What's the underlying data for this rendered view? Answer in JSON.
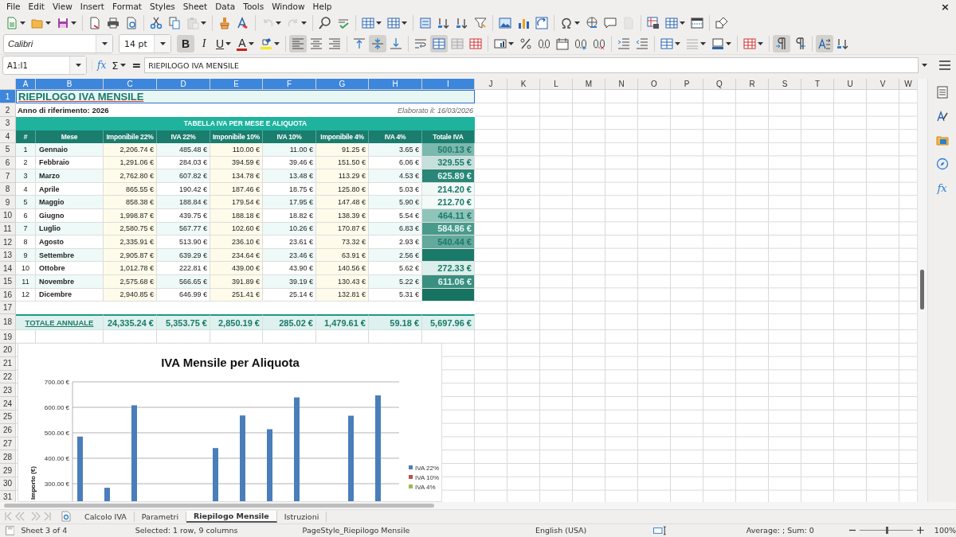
{
  "menu": [
    "File",
    "Edit",
    "View",
    "Insert",
    "Format",
    "Styles",
    "Sheet",
    "Data",
    "Tools",
    "Window",
    "Help"
  ],
  "close_button": "×",
  "toolbar_standard": [
    {
      "kind": "new",
      "dropdown": true,
      "disabled": false
    },
    {
      "kind": "open",
      "dropdown": true,
      "disabled": false
    },
    {
      "kind": "save",
      "dropdown": true,
      "disabled": false
    },
    {
      "kind": "separator"
    },
    {
      "kind": "pdf",
      "dropdown": false,
      "disabled": false
    },
    {
      "kind": "print",
      "dropdown": false,
      "disabled": false
    },
    {
      "kind": "preview",
      "dropdown": false,
      "disabled": false
    },
    {
      "kind": "separator"
    },
    {
      "kind": "cut",
      "dropdown": false,
      "disabled": false
    },
    {
      "kind": "copy",
      "dropdown": false,
      "disabled": false
    },
    {
      "kind": "paste",
      "dropdown": true,
      "disabled": true
    },
    {
      "kind": "separator"
    },
    {
      "kind": "clone",
      "dropdown": false,
      "disabled": false
    },
    {
      "kind": "clear",
      "dropdown": false,
      "disabled": false
    },
    {
      "kind": "separator"
    },
    {
      "kind": "undo",
      "dropdown": true,
      "disabled": true
    },
    {
      "kind": "redo",
      "dropdown": true,
      "disabled": true
    },
    {
      "kind": "separator"
    },
    {
      "kind": "find",
      "dropdown": false,
      "disabled": false
    },
    {
      "kind": "spelling",
      "dropdown": false,
      "disabled": false
    },
    {
      "kind": "separator"
    },
    {
      "kind": "rows",
      "dropdown": true,
      "disabled": false
    },
    {
      "kind": "cols",
      "dropdown": true,
      "disabled": false
    },
    {
      "kind": "separator"
    },
    {
      "kind": "sort",
      "dropdown": false,
      "disabled": false
    },
    {
      "kind": "sort-asc",
      "dropdown": false,
      "disabled": false
    },
    {
      "kind": "sort-desc",
      "dropdown": false,
      "disabled": false
    },
    {
      "kind": "filter",
      "dropdown": false,
      "disabled": false
    },
    {
      "kind": "separator"
    },
    {
      "kind": "image",
      "dropdown": false,
      "disabled": false
    },
    {
      "kind": "chart",
      "dropdown": false,
      "disabled": false
    },
    {
      "kind": "pivot",
      "dropdown": false,
      "disabled": false
    },
    {
      "kind": "separator"
    },
    {
      "kind": "special",
      "dropdown": true,
      "disabled": false
    },
    {
      "kind": "hyperlink",
      "dropdown": false,
      "disabled": false
    },
    {
      "kind": "comment",
      "dropdown": false,
      "disabled": false
    },
    {
      "kind": "header",
      "dropdown": false,
      "disabled": true
    },
    {
      "kind": "separator"
    },
    {
      "kind": "freeze",
      "dropdown": false,
      "disabled": false
    },
    {
      "kind": "freeze-cols",
      "dropdown": true,
      "disabled": false
    },
    {
      "kind": "split",
      "dropdown": false,
      "disabled": false
    },
    {
      "kind": "separator"
    },
    {
      "kind": "shapes",
      "dropdown": false,
      "disabled": false
    }
  ],
  "toolbar_format": {
    "font_name": "Calibri",
    "font_size": "14 pt",
    "text_buttons": [
      {
        "label": "B",
        "selected": true,
        "dropdown": false
      },
      {
        "label": "I",
        "selected": false,
        "dropdown": false
      },
      {
        "label": "U",
        "selected": false,
        "dropdown": true
      }
    ],
    "font_color": "A",
    "tools": [
      {
        "kind": "highlight",
        "dropdown": true,
        "selected": false
      },
      {
        "kind": "separator"
      },
      {
        "kind": "align-left",
        "dropdown": false,
        "selected": true
      },
      {
        "kind": "align-center",
        "dropdown": false,
        "selected": false
      },
      {
        "kind": "align-right",
        "dropdown": false,
        "selected": false
      },
      {
        "kind": "separator"
      },
      {
        "kind": "align-top",
        "dropdown": false,
        "selected": false
      },
      {
        "kind": "align-middle",
        "dropdown": false,
        "selected": true
      },
      {
        "kind": "align-bottom",
        "dropdown": false,
        "selected": false
      },
      {
        "kind": "separator"
      },
      {
        "kind": "wrap",
        "dropdown": false,
        "selected": false
      },
      {
        "kind": "merge-center",
        "dropdown": false,
        "selected": true
      },
      {
        "kind": "merge",
        "dropdown": false,
        "selected": false
      },
      {
        "kind": "unmerge",
        "dropdown": false,
        "selected": false
      },
      {
        "kind": "separator"
      },
      {
        "kind": "number-format",
        "dropdown": true,
        "selected": false
      },
      {
        "kind": "percent",
        "dropdown": false,
        "selected": false
      },
      {
        "kind": "decimal",
        "dropdown": false,
        "selected": false
      },
      {
        "kind": "date",
        "dropdown": false,
        "selected": false
      },
      {
        "kind": "add-decimal",
        "dropdown": false,
        "selected": false
      },
      {
        "kind": "del-decimal",
        "dropdown": false,
        "selected": false
      },
      {
        "kind": "separator"
      },
      {
        "kind": "indent",
        "dropdown": false,
        "selected": false
      },
      {
        "kind": "outdent",
        "dropdown": false,
        "selected": false
      },
      {
        "kind": "separator"
      },
      {
        "kind": "borders",
        "dropdown": true,
        "selected": false
      },
      {
        "kind": "border-style",
        "dropdown": true,
        "selected": false
      },
      {
        "kind": "border-color",
        "dropdown": true,
        "selected": false
      },
      {
        "kind": "separator"
      },
      {
        "kind": "conditional",
        "dropdown": true,
        "selected": false
      },
      {
        "kind": "separator"
      },
      {
        "kind": "ltr",
        "dropdown": false,
        "selected": true
      },
      {
        "kind": "rtl",
        "dropdown": false,
        "selected": false
      },
      {
        "kind": "separator"
      },
      {
        "kind": "stacked",
        "dropdown": false,
        "selected": true
      },
      {
        "kind": "text-sort",
        "dropdown": false,
        "selected": false
      }
    ]
  },
  "formula_bar": {
    "cell_ref": "A1:I1",
    "wizard": "fx",
    "sum": "Σ",
    "equals": "=",
    "content": "RIEPILOGO IVA MENSILE"
  },
  "sidebar": [
    {
      "kind": "properties"
    },
    {
      "kind": "styles"
    },
    {
      "kind": "gallery"
    },
    {
      "kind": "navigator"
    },
    {
      "kind": "functions",
      "label": "fx"
    }
  ],
  "sheet": {
    "columns": [
      {
        "label": "A",
        "selected": true
      },
      {
        "label": "B",
        "selected": true
      },
      {
        "label": "C",
        "selected": true
      },
      {
        "label": "D",
        "selected": true
      },
      {
        "label": "E",
        "selected": true
      },
      {
        "label": "F",
        "selected": true
      },
      {
        "label": "G",
        "selected": true
      },
      {
        "label": "H",
        "selected": true
      },
      {
        "label": "I",
        "selected": true
      },
      {
        "label": "J",
        "selected": false
      },
      {
        "label": "K",
        "selected": false
      },
      {
        "label": "L",
        "selected": false
      },
      {
        "label": "M",
        "selected": false
      },
      {
        "label": "N",
        "selected": false
      },
      {
        "label": "O",
        "selected": false
      },
      {
        "label": "P",
        "selected": false
      },
      {
        "label": "Q",
        "selected": false
      },
      {
        "label": "R",
        "selected": false
      },
      {
        "label": "S",
        "selected": false
      },
      {
        "label": "T",
        "selected": false
      },
      {
        "label": "U",
        "selected": false
      },
      {
        "label": "V",
        "selected": false
      },
      {
        "label": "W",
        "selected": false
      }
    ],
    "row_numbers": [
      {
        "label": "1",
        "selected": true
      },
      {
        "label": "2",
        "selected": false
      },
      {
        "label": "3",
        "selected": false
      },
      {
        "label": "4",
        "selected": false
      },
      {
        "label": "5",
        "selected": false
      },
      {
        "label": "6",
        "selected": false
      },
      {
        "label": "7",
        "selected": false
      },
      {
        "label": "8",
        "selected": false
      },
      {
        "label": "9",
        "selected": false
      },
      {
        "label": "10",
        "selected": false
      },
      {
        "label": "11",
        "selected": false
      },
      {
        "label": "12",
        "selected": false
      },
      {
        "label": "13",
        "selected": false
      },
      {
        "label": "14",
        "selected": false
      },
      {
        "label": "15",
        "selected": false
      },
      {
        "label": "16",
        "selected": false
      },
      {
        "label": "17",
        "selected": false
      },
      {
        "label": "18",
        "selected": false
      },
      {
        "label": "19",
        "selected": false
      },
      {
        "label": "20",
        "selected": false
      },
      {
        "label": "21",
        "selected": false
      },
      {
        "label": "22",
        "selected": false
      },
      {
        "label": "23",
        "selected": false
      },
      {
        "label": "24",
        "selected": false
      },
      {
        "label": "25",
        "selected": false
      },
      {
        "label": "26",
        "selected": false
      },
      {
        "label": "27",
        "selected": false
      },
      {
        "label": "28",
        "selected": false
      },
      {
        "label": "29",
        "selected": false
      },
      {
        "label": "30",
        "selected": false
      },
      {
        "label": "31",
        "selected": false
      }
    ],
    "title": "RIEPILOGO IVA MENSILE",
    "year_label": "Anno di riferimento: 2026",
    "date_label": "Elaborato il: 16/03/2026",
    "banner": "TABELLA IVA PER MESE E ALIQUOTA",
    "headers": [
      "#",
      "Mese",
      "Imponibile 22%",
      "IVA 22%",
      "Imponibile 10%",
      "IVA 10%",
      "Imponibile 4%",
      "IVA 4%",
      "Totale IVA"
    ],
    "rows": [
      {
        "n": "1",
        "month": "Gennaio",
        "values": [
          "2,206.74 €",
          "485.48 €",
          "110.00 €",
          "11.00 €",
          "91.25 €",
          "3.65 €"
        ],
        "total": "500.13 €",
        "color": "#7bb8ad"
      },
      {
        "n": "2",
        "month": "Febbraio",
        "values": [
          "1,291.06 €",
          "284.03 €",
          "394.59 €",
          "39.46 €",
          "151.50 €",
          "6.06 €"
        ],
        "total": "329.55 €",
        "color": "#c6e0dc"
      },
      {
        "n": "3",
        "month": "Marzo",
        "values": [
          "2,762.80 €",
          "607.82 €",
          "134.78 €",
          "13.48 €",
          "113.29 €",
          "4.53 €"
        ],
        "total": "625.89 €",
        "color": "#2a8677"
      },
      {
        "n": "4",
        "month": "Aprile",
        "values": [
          "865.55 €",
          "190.42 €",
          "187.46 €",
          "18.75 €",
          "125.80 €",
          "5.03 €"
        ],
        "total": "214.20 €",
        "color": "#f1f9f7"
      },
      {
        "n": "5",
        "month": "Maggio",
        "values": [
          "858.38 €",
          "188.84 €",
          "179.54 €",
          "17.95 €",
          "147.48 €",
          "5.90 €"
        ],
        "total": "212.70 €",
        "color": "#f3faf8"
      },
      {
        "n": "6",
        "month": "Giugno",
        "values": [
          "1,998.87 €",
          "439.75 €",
          "188.18 €",
          "18.82 €",
          "138.39 €",
          "5.54 €"
        ],
        "total": "464.11 €",
        "color": "#8ec4ba"
      },
      {
        "n": "7",
        "month": "Luglio",
        "values": [
          "2,580.75 €",
          "567.77 €",
          "102.60 €",
          "10.26 €",
          "170.87 €",
          "6.83 €"
        ],
        "total": "584.86 €",
        "color": "#4a9a8c"
      },
      {
        "n": "8",
        "month": "Agosto",
        "values": [
          "2,335.91 €",
          "513.90 €",
          "236.10 €",
          "23.61 €",
          "73.32 €",
          "2.93 €"
        ],
        "total": "540.44 €",
        "color": "#63a99c"
      },
      {
        "n": "9",
        "month": "Settembre",
        "values": [
          "2,905.87 €",
          "639.29 €",
          "234.64 €",
          "23.46 €",
          "63.91 €",
          "2.56 €"
        ],
        "color": "#1a7a6a"
      },
      {
        "n": "10",
        "month": "Ottobre",
        "values": [
          "1,012.78 €",
          "222.81 €",
          "439.00 €",
          "43.90 €",
          "140.56 €",
          "5.62 €"
        ],
        "total": "272.33 €",
        "color": "#dcefeb"
      },
      {
        "n": "11",
        "month": "Novembre",
        "values": [
          "2,575.68 €",
          "566.65 €",
          "391.89 €",
          "39.19 €",
          "130.43 €",
          "5.22 €"
        ],
        "total": "611.06 €",
        "color": "#3a8f80"
      },
      {
        "n": "12",
        "month": "Dicembre",
        "values": [
          "2,940.85 €",
          "646.99 €",
          "251.41 €",
          "25.14 €",
          "132.81 €",
          "5.31 €"
        ],
        "color": "#16735f"
      }
    ],
    "totals": {
      "label": "TOTALE ANNUALE",
      "values": [
        "24,335.24 €",
        "5,353.75 €",
        "2,850.19 €",
        "285.02 €",
        "1,479.61 €",
        "59.18 €",
        "5,697.96 €"
      ]
    },
    "chart": {
      "chart_data": {
        "type": "bar",
        "stacked": false,
        "grid": true,
        "title": "IVA Mensile per Aliquota",
        "ylabel": "Importo (€)",
        "ylim": [
          225,
          700
        ],
        "yticks": [
          {
            "value": 300,
            "label": "300.00 €"
          },
          {
            "value": 400,
            "label": "400.00 €"
          },
          {
            "value": 500,
            "label": "500.00 €"
          },
          {
            "value": 600,
            "label": "600.00 €"
          },
          {
            "value": 700,
            "label": "700.00 €"
          }
        ],
        "series": [
          {
            "name": "IVA 22%",
            "color": "#4a7ebb",
            "values": [
              485,
              284,
              608,
              null,
              null,
              440,
              568,
              514,
              639,
              null,
              567,
              647
            ]
          },
          {
            "name": "IVA 10%",
            "color": "#c0504d",
            "values": [
              null,
              null,
              null,
              null,
              null,
              null,
              null,
              null,
              null,
              null,
              null,
              null
            ]
          },
          {
            "name": "IVA 4%",
            "color": "#9bbb59",
            "values": [
              null,
              null,
              null,
              null,
              null,
              null,
              null,
              null,
              null,
              null,
              null,
              null
            ]
          }
        ]
      }
    }
  },
  "sheet_tabs": [
    {
      "label": "Calcolo IVA",
      "selected": false
    },
    {
      "label": "Parametri",
      "selected": false
    },
    {
      "label": "Riepilogo Mensile",
      "selected": true
    },
    {
      "label": "Istruzioni",
      "selected": false
    }
  ],
  "status_bar": {
    "sheet": "Sheet 3 of 4",
    "selection": "Selected: 1 row, 9 columns",
    "page_style": "PageStyle_Riepilogo Mensile",
    "language": "English (USA)",
    "sum": "Average: ; Sum: 0",
    "zoom": {
      "level": 0.5,
      "label": "100%"
    }
  }
}
